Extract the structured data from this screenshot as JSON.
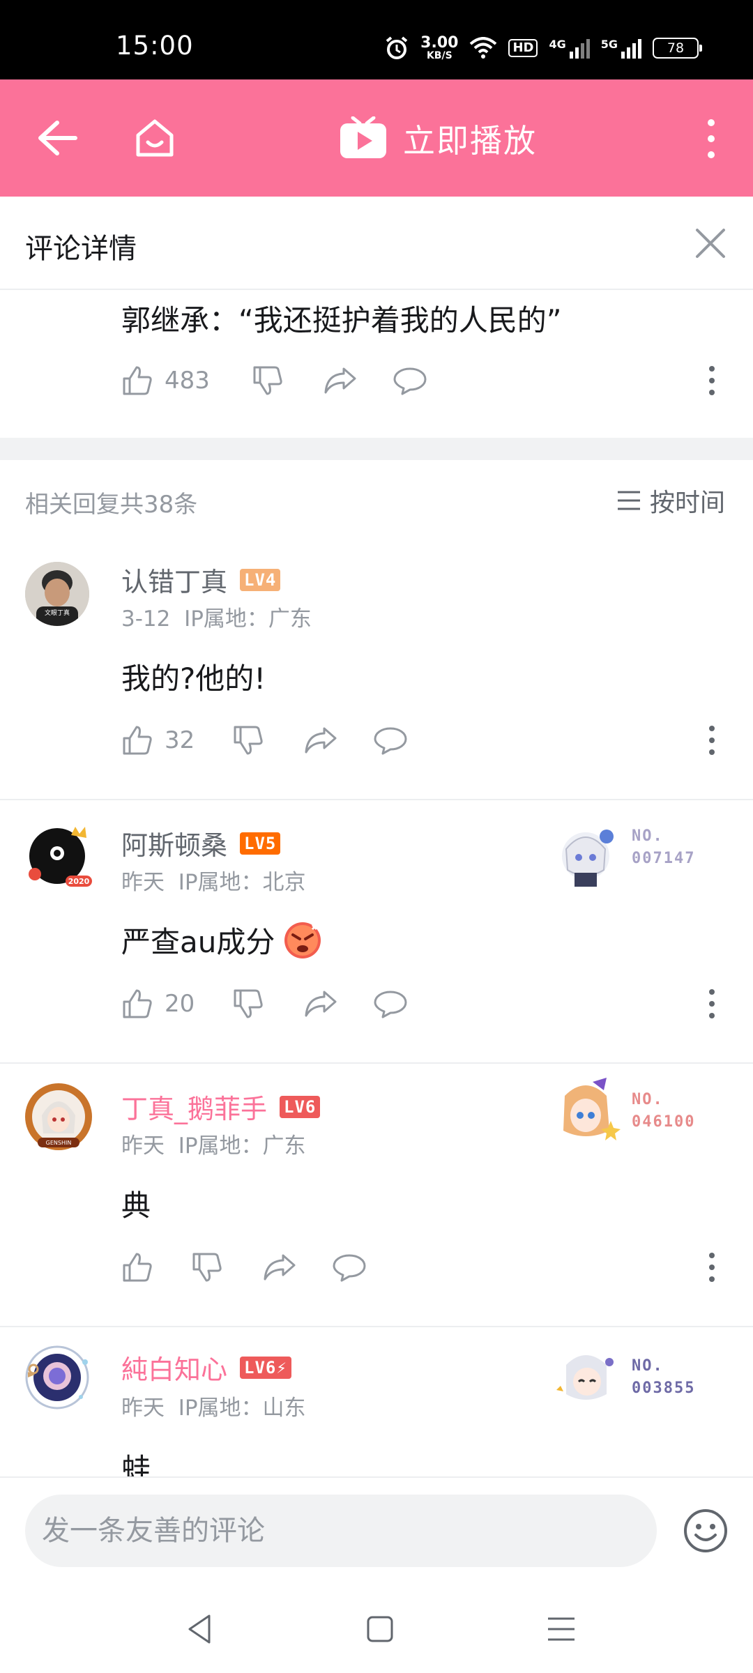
{
  "status_bar": {
    "time": "15:00",
    "net_speed_value": "3.00",
    "net_speed_unit": "KB/S",
    "hd_label": "HD",
    "signal1_label": "4G",
    "signal2_label": "5G",
    "battery": "78"
  },
  "app_bar": {
    "play_label": "立即播放",
    "bg_color": "#fb7299",
    "icons": [
      "back-arrow-icon",
      "home-icon",
      "tv-play-icon",
      "more-vertical-icon"
    ]
  },
  "panel": {
    "title": "评论详情",
    "close_icon": "close-icon"
  },
  "root_comment": {
    "text": "郭继承：“我还挺护着我的人民的”",
    "likes": "483"
  },
  "replies_header": {
    "count_text": "相关回复共38条",
    "sort_label": "按时间"
  },
  "replies": [
    {
      "username": "认错丁真",
      "level": "LV4",
      "level_color": "#f6b076",
      "date": "3-12",
      "ip_location": "IP属地：广东",
      "content": "我的?他的!",
      "likes": "32",
      "name_style": "normal",
      "avatar_text": "文眼丁真"
    },
    {
      "username": "阿斯顿桑",
      "level": "LV5",
      "level_color": "#ff6c00",
      "date": "昨天",
      "ip_location": "IP属地：北京",
      "content": "严查au成分",
      "content_emoji": "angry-emoji",
      "likes": "20",
      "name_style": "normal",
      "avatar_text": "2020",
      "fan_badge": {
        "no_label": "NO.",
        "number": "007147",
        "color": "#a7a2c6"
      }
    },
    {
      "username": "丁真_鹅菲手",
      "level": "LV6",
      "level_color": "#ee5a5a",
      "date": "昨天",
      "ip_location": "IP属地：广东",
      "content": "典",
      "likes": "",
      "name_style": "pink",
      "avatar_text": "GENSHIN",
      "fan_badge": {
        "no_label": "NO.",
        "number": "046100",
        "color": "#e78a8a"
      }
    },
    {
      "username": "純白知心",
      "level": "LV6⚡",
      "level_color": "#ee5a5a",
      "date": "昨天",
      "ip_location": "IP属地：山东",
      "content": "蛙",
      "likes": "",
      "name_style": "pink",
      "fan_badge": {
        "no_label": "NO.",
        "number": "003855",
        "color": "#6e6aa6"
      }
    }
  ],
  "input_bar": {
    "placeholder": "发一条友善的评论",
    "emoji_icon": "emoji-icon"
  },
  "nav_bar": {
    "icons": [
      "nav-back-icon",
      "nav-home-icon",
      "nav-menu-icon"
    ]
  }
}
